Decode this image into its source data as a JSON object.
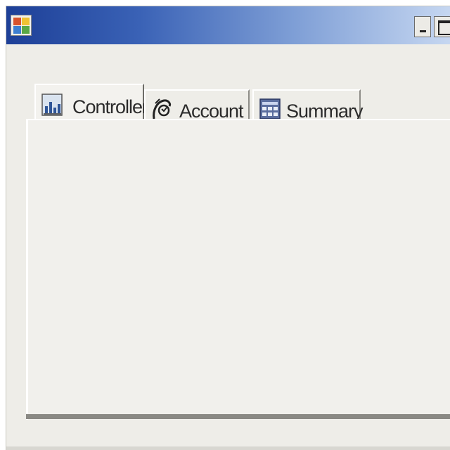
{
  "window": {
    "title": "",
    "icon": "app-icon",
    "controls": {
      "minimize_icon": "minimize-icon",
      "maximize_icon": "maximize-icon"
    }
  },
  "tabs": [
    {
      "label": "Controller",
      "icon": "controller-chart-icon",
      "active": true
    },
    {
      "label": "Account",
      "icon": "account-icon",
      "active": false
    },
    {
      "label": "Summary",
      "icon": "summary-table-icon",
      "active": false
    }
  ],
  "colors": {
    "titlebar_start": "#1d3f97",
    "titlebar_end": "#c6d7f1",
    "window_bg": "#eeede8"
  }
}
